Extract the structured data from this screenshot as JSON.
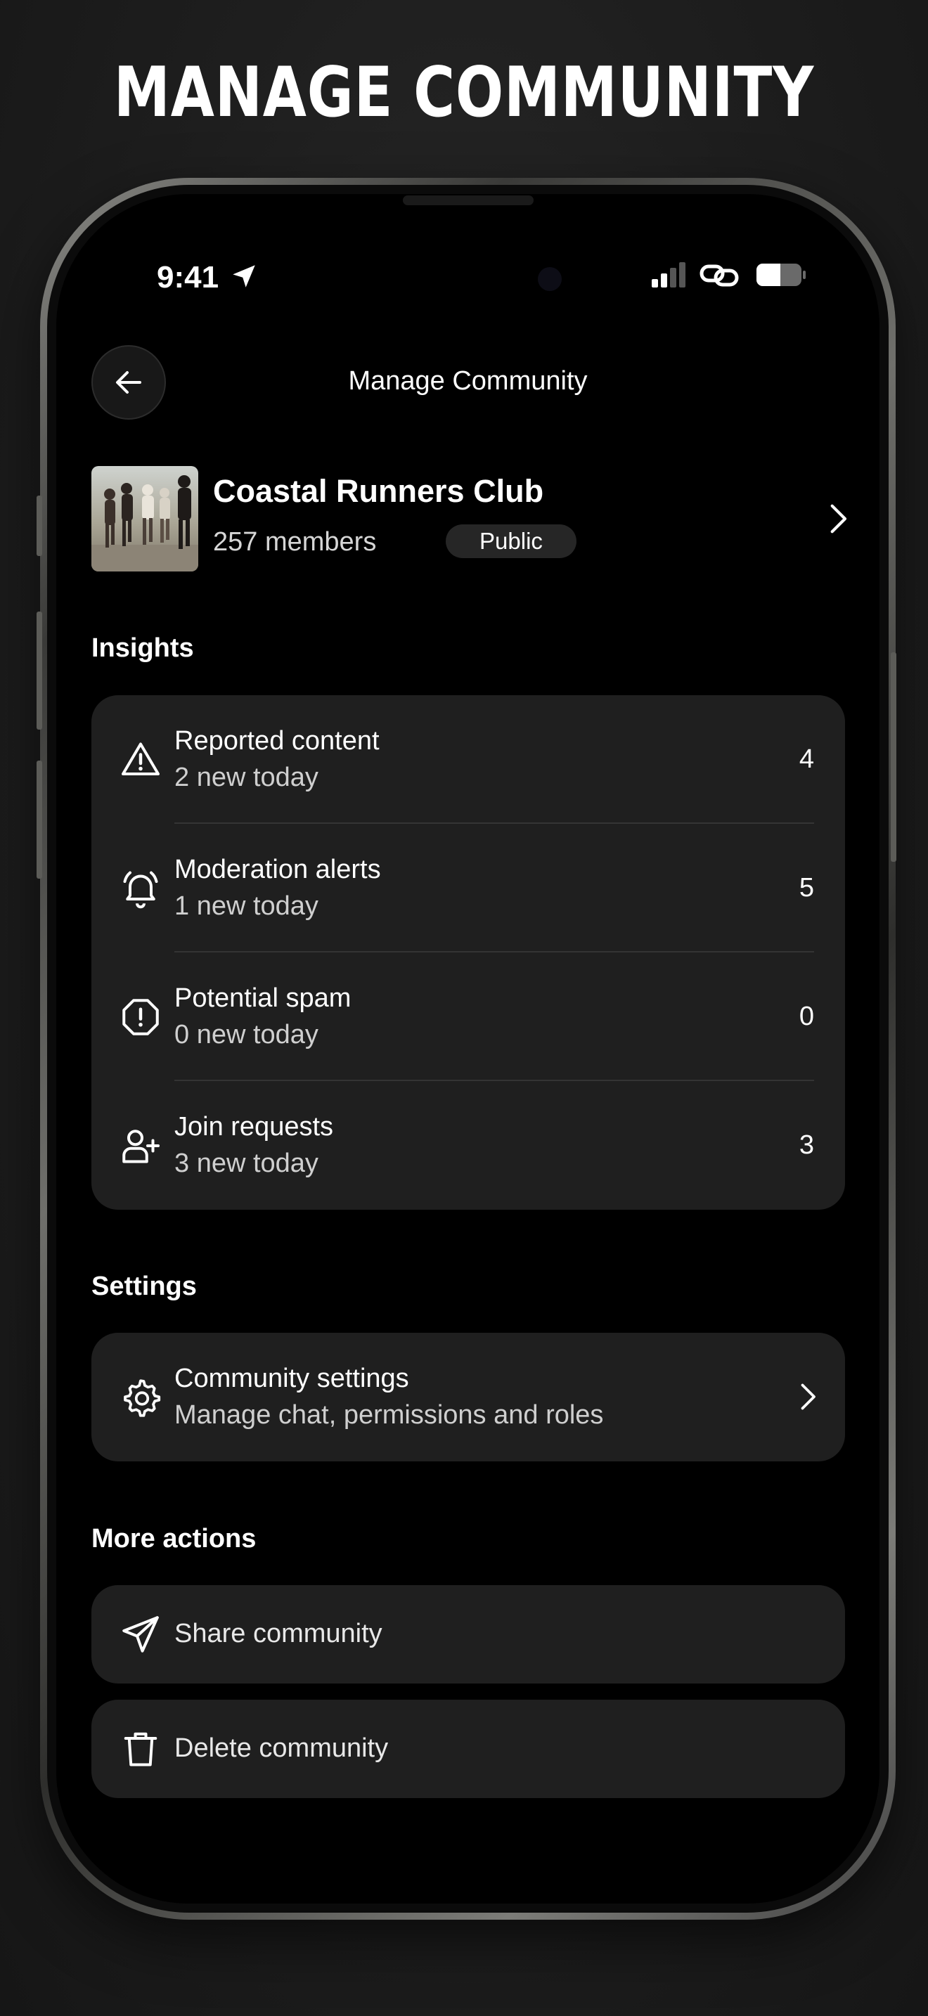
{
  "headline": "MANAGE COMMUNITY",
  "status_bar": {
    "time": "9:41"
  },
  "nav": {
    "title": "Manage Community"
  },
  "community": {
    "name": "Coastal Runners Club",
    "members": "257 members",
    "visibility": "Public"
  },
  "insights": {
    "title": "Insights",
    "items": [
      {
        "icon": "warning-triangle-icon",
        "label": "Reported content",
        "sub": "2 new today",
        "count": "4"
      },
      {
        "icon": "bell-icon",
        "label": "Moderation alerts",
        "sub": "1 new today",
        "count": "5"
      },
      {
        "icon": "alert-octagon-icon",
        "label": "Potential spam",
        "sub": "0 new today",
        "count": "0"
      },
      {
        "icon": "user-plus-icon",
        "label": "Join requests",
        "sub": "3 new today",
        "count": "3"
      }
    ]
  },
  "settings": {
    "title": "Settings",
    "item": {
      "icon": "gear-icon",
      "label": "Community settings",
      "sub": "Manage  chat, permissions and roles"
    }
  },
  "more_actions": {
    "title": "More actions",
    "share": {
      "icon": "send-icon",
      "label": "Share community"
    },
    "delete": {
      "icon": "trash-icon",
      "label": "Delete community"
    }
  },
  "colors": {
    "background": "#000000",
    "card": "#1f1f1f",
    "text": "#ffffff",
    "subtext": "#cfcfcf"
  }
}
